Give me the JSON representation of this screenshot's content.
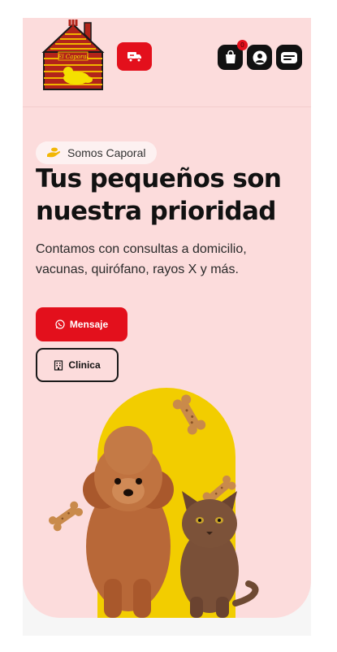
{
  "header": {
    "logo_text": "El Caporal",
    "delivery_icon": "truck-icon",
    "cart_icon": "shopping-bag-icon",
    "cart_count": "0",
    "user_icon": "user-icon",
    "menu_icon": "menu-icon"
  },
  "hero": {
    "badge": "Somos Caporal",
    "title_line1": "Tus pequeños son",
    "title_line2": "nuestra prioridad",
    "desc_line1": "Contamos con consultas a domicilio,",
    "desc_line2": "vacunas, quirófano, rayos X y más.",
    "btn_message": "Mensaje",
    "btn_message_icon": "whatsapp-icon",
    "btn_clinic": "Clinica",
    "btn_clinic_icon": "building-icon"
  },
  "colors": {
    "accent": "#e3101c",
    "hero_bg": "#fcdcdc",
    "text_dark": "#111111",
    "circle": "#f2cd00"
  }
}
